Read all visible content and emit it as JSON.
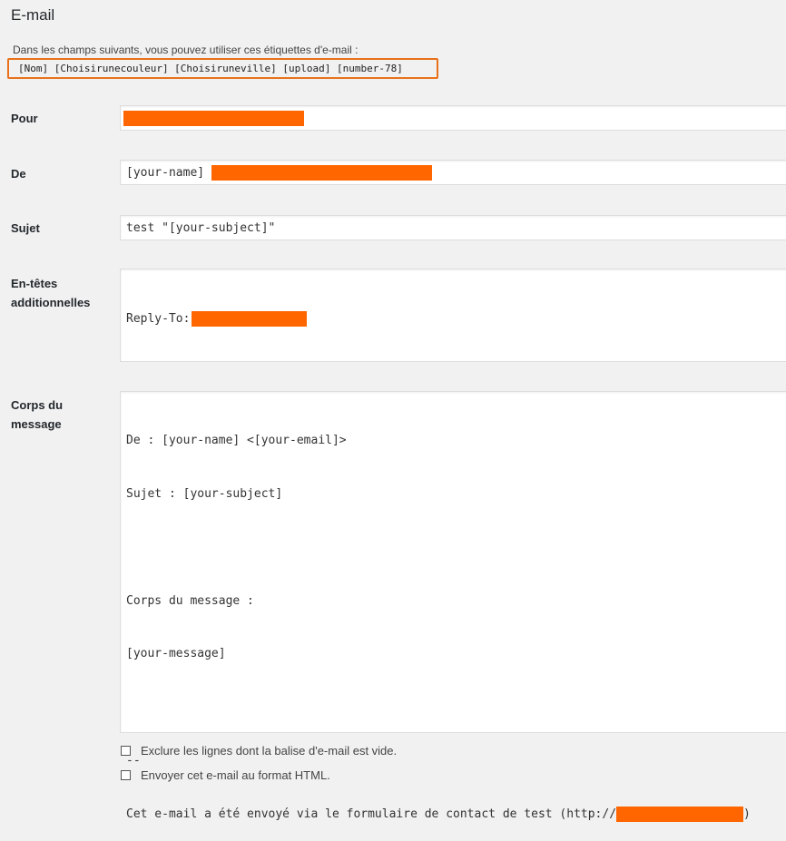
{
  "section": {
    "title": "E-mail"
  },
  "tags": {
    "intro": "Dans les champs suivants, vous pouvez utiliser ces étiquettes d'e-mail :",
    "list": "[Nom] [Choisirunecouleur] [Choisiruneville] [upload] [number-78]"
  },
  "fields": {
    "pour": {
      "label": "Pour",
      "value": ""
    },
    "de": {
      "label": "De",
      "value": "[your-name] "
    },
    "sujet": {
      "label": "Sujet",
      "value": "test \"[your-subject]\""
    },
    "entetes": {
      "label_line1": "En-têtes",
      "label_line2": "additionnelles",
      "value": "Reply-To: "
    },
    "corps": {
      "label_line1": "Corps du",
      "label_line2": "message",
      "lines": [
        "De : [your-name] <[your-email]>",
        "Sujet : [your-subject]",
        "",
        "Corps du message :",
        "[your-message]",
        "",
        "--",
        "Cet e-mail a été envoyé via le formulaire de contact de test (http://"
      ],
      "last_line_suffix": ")"
    }
  },
  "options": {
    "exclude_empty": "Exclure les lignes dont la balise d'e-mail est vide.",
    "html_format": "Envoyer cet e-mail au format HTML."
  },
  "colors": {
    "redaction": "#ff6600",
    "highlight_border": "#e8711a"
  }
}
